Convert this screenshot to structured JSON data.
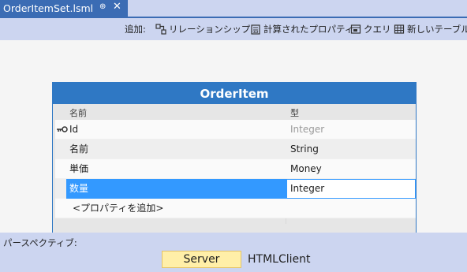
{
  "tab": {
    "title": "OrderItemSet.lsml",
    "pin_glyph": "⊕",
    "close_glyph": "✕"
  },
  "toolbar": {
    "add_label": "追加:",
    "items": [
      {
        "label": "リレーションシップ...",
        "icon": "relationship-icon"
      },
      {
        "label": "計算されたプロパティ",
        "icon": "computed-property-icon"
      },
      {
        "label": "クエリ",
        "icon": "query-icon"
      },
      {
        "label": "新しいテーブル",
        "icon": "new-table-icon"
      }
    ]
  },
  "entity": {
    "title": "OrderItem",
    "headers": {
      "name": "名前",
      "type": "型"
    },
    "rows": [
      {
        "name": "Id",
        "type": "Integer",
        "key": true
      },
      {
        "name": "名前",
        "type": "String"
      },
      {
        "name": "単価",
        "type": "Money"
      },
      {
        "name": "数量",
        "type": "Integer",
        "selected": true
      }
    ],
    "add_property": "<プロパティを追加>"
  },
  "perspective": {
    "label": "パースペクティブ:",
    "options": [
      "Server",
      "HTMLClient"
    ],
    "selected": "Server"
  },
  "colors": {
    "accent": "#2f78c4",
    "selection": "#3399ff",
    "toolbar_bg": "#ccd5f0",
    "server_highlight": "#ffefa8"
  }
}
